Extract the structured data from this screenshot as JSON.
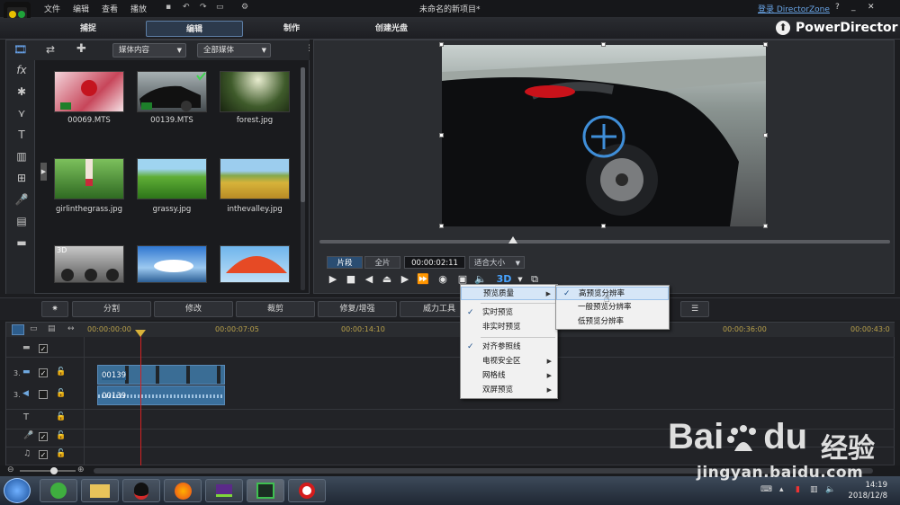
{
  "menubar": {
    "items": [
      "文件",
      "编辑",
      "查看",
      "播放"
    ],
    "title": "未命名的新项目*",
    "login_link": "登录 DirectorZone",
    "help": "?"
  },
  "tabs": [
    "捕捉",
    "编辑",
    "制作",
    "创建光盘"
  ],
  "brand": "PowerDirector",
  "library": {
    "dropdown1": "媒体内容",
    "dropdown2": "全部媒体",
    "media": [
      "00069.MTS",
      "00139.MTS",
      "forest.jpg",
      "girlinthegrass.jpg",
      "grassy.jpg",
      "inthevalley.jpg",
      "",
      "",
      ""
    ],
    "badge_3d": "3D"
  },
  "preview": {
    "seg_clip": "片段",
    "seg_full": "全片",
    "timecode": "00:00:02:11",
    "fit": "适合大小",
    "label_3d": "3D"
  },
  "editbar": [
    "分割",
    "修改",
    "裁剪",
    "修复/增强",
    "威力工具"
  ],
  "timeline": {
    "ruler": [
      "00:00:00:00",
      "00:00:07:05",
      "00:00:14:10",
      "00:00:36:00",
      "00:00:43:0"
    ],
    "tracks": [
      {
        "num": "3.",
        "clip": "00139"
      },
      {
        "num": "3.",
        "clip": "00139"
      }
    ]
  },
  "context_menu": {
    "items": [
      {
        "label": "预览质量",
        "check": false,
        "submenu": true
      },
      {
        "label": "实时预览",
        "check": true,
        "submenu": false
      },
      {
        "label": "非实时预览",
        "check": false,
        "submenu": false
      },
      {
        "label": "对齐参照线",
        "check": true,
        "submenu": false
      },
      {
        "label": "电视安全区",
        "check": false,
        "submenu": true
      },
      {
        "label": "网格线",
        "check": false,
        "submenu": true
      },
      {
        "label": "双屏预览",
        "check": false,
        "submenu": true
      }
    ],
    "submenu": [
      {
        "label": "高预览分辨率",
        "check": true
      },
      {
        "label": "一般预览分辨率",
        "check": false
      },
      {
        "label": "低预览分辨率",
        "check": false
      }
    ]
  },
  "taskbar": {
    "time": "14:19",
    "date": "2018/12/8"
  },
  "watermark": {
    "brand": "Bai",
    "brand2": "du",
    "cn": "经验",
    "url": "jingyan.baidu.com"
  }
}
